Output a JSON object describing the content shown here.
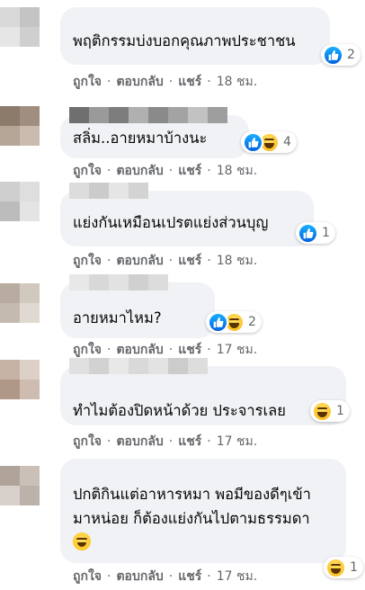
{
  "colors": {
    "bubble_bg": "#f0f2f5",
    "text": "#050505",
    "secondary_text": "#65676b",
    "like_blue": "#1877f2",
    "haha_yellow": "#fcc42b"
  },
  "actions": {
    "like": "ถูกใจ",
    "reply": "ตอบกลับ",
    "share": "แชร์",
    "separator": "·"
  },
  "comments": [
    {
      "text": "พฤติกรรมบ่งบอกคุณภาพประชาชน",
      "reactions": [
        "like-icon"
      ],
      "count": "2",
      "time": "18 ชม."
    },
    {
      "text": "สลิ่ม..อายหมาบ้างนะ",
      "reactions": [
        "like-icon",
        "haha-icon"
      ],
      "count": "4",
      "time": "18 ชม."
    },
    {
      "text": "แย่งกันเหมือนเปรตแย่งส่วนบุญ",
      "reactions": [
        "like-icon"
      ],
      "count": "1",
      "time": "18 ชม."
    },
    {
      "text": "อายหมาไหม?",
      "reactions": [
        "like-icon",
        "haha-icon"
      ],
      "count": "2",
      "time": "17 ชม."
    },
    {
      "text": "ทำไมต้องปิดหน้าด้วย ประจารเลย",
      "reactions": [
        "haha-icon"
      ],
      "count": "1",
      "time": "17 ชม."
    },
    {
      "text": "ปกติกินแต่อาหารหมา พอมีของดีๆเข้ามาหน่อย ก็ต้องแย่งกันไปตามธรรมดา",
      "trailing_emoji": "grinning-squinting-face-emoji",
      "reactions": [
        "haha-icon"
      ],
      "count": "1",
      "time": "17 ชม."
    }
  ]
}
